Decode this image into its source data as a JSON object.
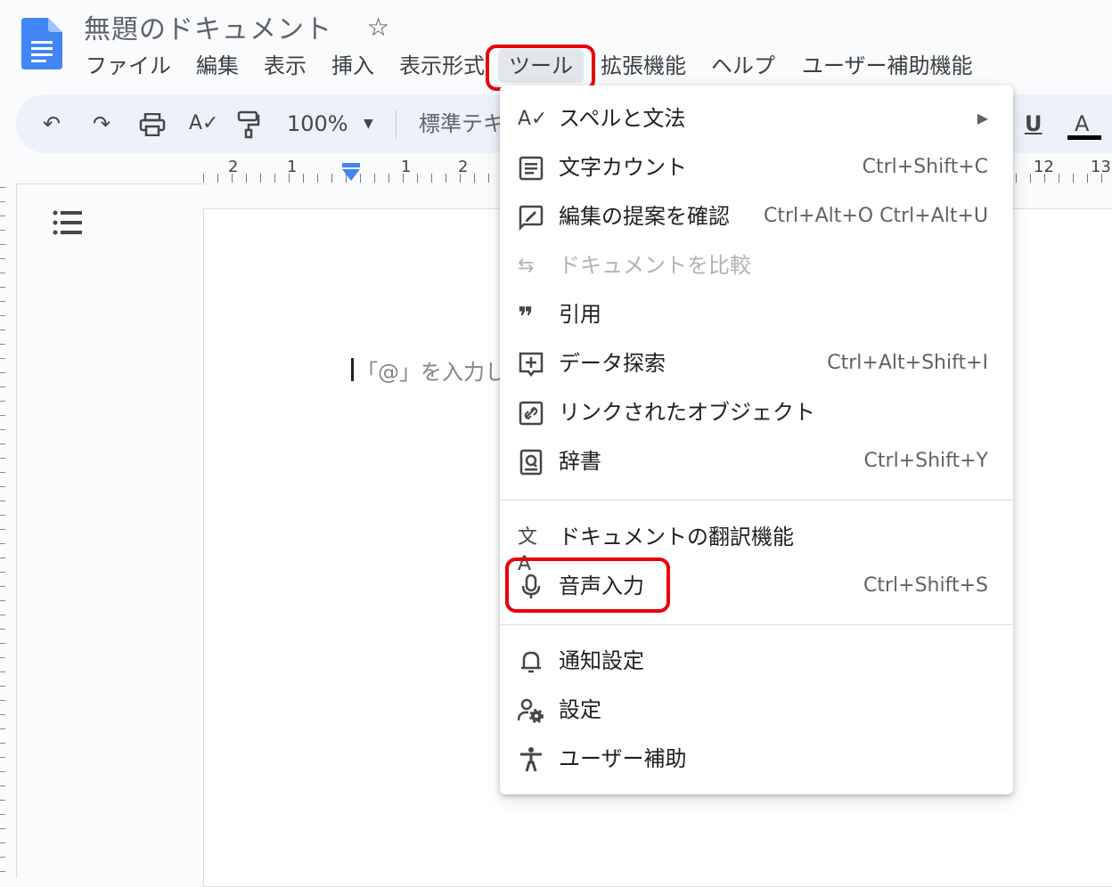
{
  "header": {
    "title": "無題のドキュメント",
    "star_icon": "star-outline-icon"
  },
  "menubar": [
    "ファイル",
    "編集",
    "表示",
    "挿入",
    "表示形式",
    "ツール",
    "拡張機能",
    "ヘルプ",
    "ユーザー補助機能"
  ],
  "toolbar": {
    "zoom": "100%",
    "style": "標準テキ",
    "underline": "U",
    "text_color": "A"
  },
  "ruler": [
    "2",
    "1",
    "1",
    "2",
    "12",
    "13"
  ],
  "document": {
    "placeholder": "「@」を入力し"
  },
  "tools_menu": {
    "items": [
      {
        "label": "スペルと文法",
        "shortcut": "",
        "icon": "spellcheck-icon",
        "submenu": true
      },
      {
        "label": "文字カウント",
        "shortcut": "Ctrl+Shift+C",
        "icon": "word-count-icon"
      },
      {
        "label": "編集の提案を確認",
        "shortcut": "Ctrl+Alt+O Ctrl+Alt+U",
        "icon": "review-edits-icon"
      },
      {
        "label": "ドキュメントを比較",
        "shortcut": "",
        "icon": "compare-icon",
        "disabled": true
      },
      {
        "label": "引用",
        "shortcut": "",
        "icon": "quote-icon"
      },
      {
        "label": "データ探索",
        "shortcut": "Ctrl+Alt+Shift+I",
        "icon": "explore-icon"
      },
      {
        "label": "リンクされたオブジェクト",
        "shortcut": "",
        "icon": "linked-objects-icon"
      },
      {
        "label": "辞書",
        "shortcut": "Ctrl+Shift+Y",
        "icon": "dictionary-icon"
      },
      {
        "label": "ドキュメントの翻訳機能",
        "shortcut": "",
        "icon": "translate-icon"
      },
      {
        "label": "音声入力",
        "shortcut": "Ctrl+Shift+S",
        "icon": "microphone-icon"
      },
      {
        "label": "通知設定",
        "shortcut": "",
        "icon": "bell-icon"
      },
      {
        "label": "設定",
        "shortcut": "",
        "icon": "settings-person-icon"
      },
      {
        "label": "ユーザー補助",
        "shortcut": "",
        "icon": "accessibility-icon"
      }
    ]
  },
  "colors": {
    "highlight": "#e8000b",
    "docs_blue": "#4285f4",
    "text_color_bar": "#000000"
  }
}
